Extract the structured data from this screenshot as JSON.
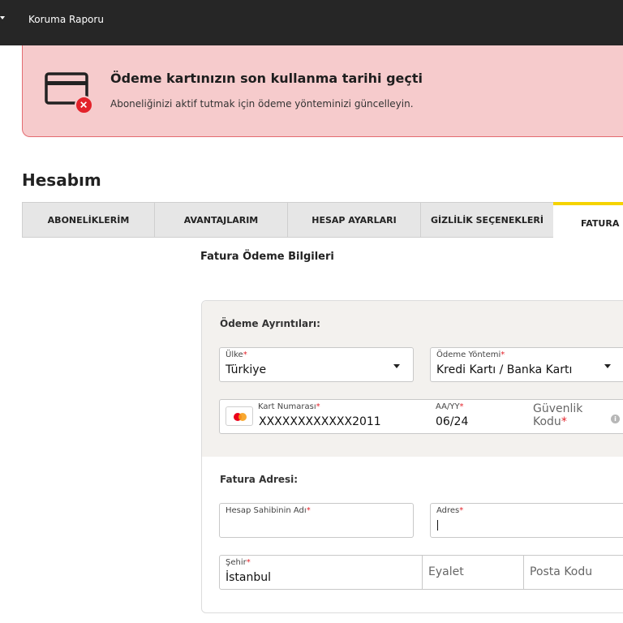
{
  "topbar": {
    "nav_link": "Koruma Raporu"
  },
  "alert": {
    "title": "Ödeme kartınızın son kullanma tarihi geçti",
    "subtitle": "Aboneliğinizi aktif tutmak için ödeme yönteminizi güncelleyin."
  },
  "page_title": "Hesabım",
  "tabs": [
    "ABONELİKLERİM",
    "AVANTAJLARIM",
    "HESAP AYARLARI",
    "GİZLİLİK SEÇENEKLERİ",
    "FATURA B"
  ],
  "section_heading": "Fatura Ödeme Bilgileri",
  "payment": {
    "group_label": "Ödeme Ayrıntıları:",
    "country": {
      "label": "Ülke",
      "value": "Türkiye"
    },
    "method": {
      "label": "Ödeme Yöntemi",
      "value": "Kredi Kartı / Banka Kartı"
    },
    "card_number": {
      "label": "Kart Numarası",
      "value": "XXXXXXXXXXXX2011"
    },
    "expiry": {
      "label": "AA/YY",
      "value": "06/24"
    },
    "security_code": {
      "label_line1": "Güvenlik",
      "label_line2": "Kodu"
    }
  },
  "billing": {
    "group_label": "Fatura Adresi:",
    "holder_name": {
      "label": "Hesap Sahibinin Adı",
      "value": ""
    },
    "address": {
      "label": "Adres",
      "value": ""
    },
    "city": {
      "label": "Şehir",
      "value": "İstanbul"
    },
    "state": {
      "placeholder": "Eyalet"
    },
    "postal_code": {
      "placeholder": "Posta Kodu"
    }
  },
  "colors": {
    "alert_bg": "#f6cbcc",
    "alert_border": "#e36b70",
    "error_red": "#e3222a",
    "active_tab_accent": "#f5d300",
    "topbar": "#262626"
  },
  "icons": [
    "chevron-down-icon",
    "credit-card-icon",
    "error-badge-icon",
    "mastercard-icon",
    "info-icon"
  ]
}
